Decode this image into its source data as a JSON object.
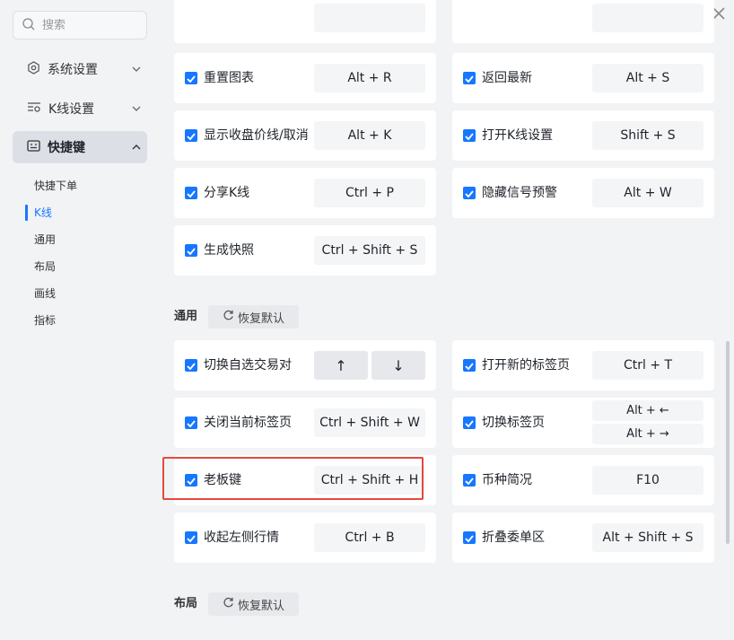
{
  "search": {
    "placeholder": "搜索"
  },
  "sidebar": {
    "items": [
      {
        "label": "系统设置"
      },
      {
        "label": "K线设置"
      },
      {
        "label": "快捷键"
      }
    ],
    "sub_items": [
      "快捷下单",
      "K线",
      "通用",
      "布局",
      "画线",
      "指标"
    ]
  },
  "colors": {
    "accent": "#1677ff",
    "highlight": "#e5483f"
  },
  "kline_cards": [
    {
      "name": "",
      "key": ""
    },
    {
      "name": "",
      "key": ""
    },
    {
      "name": "重置图表",
      "key": "Alt + R"
    },
    {
      "name": "返回最新",
      "key": "Alt + S"
    },
    {
      "name": "显示收盘价线/取消",
      "key": "Alt + K"
    },
    {
      "name": "打开K线设置",
      "key": "Shift + S"
    },
    {
      "name": "分享K线",
      "key": "Ctrl + P"
    },
    {
      "name": "隐藏信号预警",
      "key": "Alt + W"
    },
    {
      "name": "生成快照",
      "key": "Ctrl + Shift + S"
    }
  ],
  "general": {
    "title": "通用",
    "reset_label": "恢复默认",
    "cards": [
      {
        "name": "切换自选交易对",
        "key_up": "↑",
        "key_down": "↓"
      },
      {
        "name": "打开新的标签页",
        "key": "Ctrl + T"
      },
      {
        "name": "关闭当前标签页",
        "key": "Ctrl + Shift + W"
      },
      {
        "name": "切换标签页",
        "key_a": "Alt + ←",
        "key_b": "Alt + →"
      },
      {
        "name": "老板键",
        "key": "Ctrl + Shift + H"
      },
      {
        "name": "币种简况",
        "key": "F10"
      },
      {
        "name": "收起左侧行情",
        "key": "Ctrl + B"
      },
      {
        "name": "折叠委单区",
        "key": "Alt + Shift + S"
      }
    ]
  },
  "layout": {
    "title": "布局",
    "reset_label": "恢复默认"
  }
}
